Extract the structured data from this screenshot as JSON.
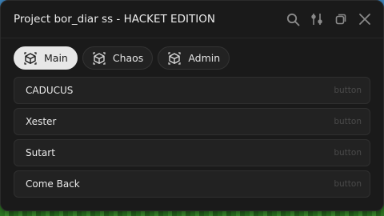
{
  "window": {
    "title": "Project bor_diar ss - HACKET EDITION",
    "controls": [
      "search-icon",
      "settings-sliders-icon",
      "minimize-icon",
      "close-icon"
    ]
  },
  "tabs": [
    {
      "label": "Main",
      "icon": "cube-icon",
      "active": true
    },
    {
      "label": "Chaos",
      "icon": "cube-icon",
      "active": false
    },
    {
      "label": "Admin",
      "icon": "cube-icon",
      "active": false
    }
  ],
  "items": [
    {
      "label": "CADUCUS",
      "type": "button"
    },
    {
      "label": "Xester",
      "type": "button"
    },
    {
      "label": "Sutart",
      "type": "button"
    },
    {
      "label": "Come Back",
      "type": "button"
    }
  ],
  "colors": {
    "window_bg": "#1a1a1a",
    "row_bg": "#222222",
    "active_tab_bg": "#e7e7e7",
    "muted_text": "#4a4a4a"
  }
}
